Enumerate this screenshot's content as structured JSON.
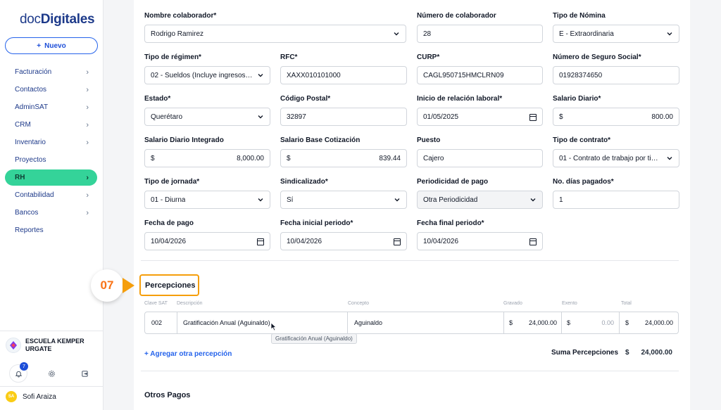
{
  "app": {
    "logo_prefix": "doc",
    "logo_brand": "Digitales",
    "new_button": "Nuevo"
  },
  "sidebar": {
    "items": [
      {
        "label": "Facturación",
        "chevron": true,
        "active": false
      },
      {
        "label": "Contactos",
        "chevron": true,
        "active": false
      },
      {
        "label": "AdminSAT",
        "chevron": true,
        "active": false
      },
      {
        "label": "CRM",
        "chevron": true,
        "active": false
      },
      {
        "label": "Inventario",
        "chevron": true,
        "active": false
      },
      {
        "label": "Proyectos",
        "chevron": false,
        "active": false
      },
      {
        "label": "RH",
        "chevron": true,
        "active": true
      },
      {
        "label": "Contabilidad",
        "chevron": true,
        "active": false
      },
      {
        "label": "Bancos",
        "chevron": true,
        "active": false
      },
      {
        "label": "Reportes",
        "chevron": false,
        "active": false
      }
    ],
    "org_name": "ESCUELA KEMPER URGATE",
    "notification_count": "7",
    "user_initials": "SA",
    "user_name": "Sofi Araiza"
  },
  "form": {
    "nombre_colaborador": {
      "label": "Nombre colaborador*",
      "value": "Rodrigo Ramirez"
    },
    "numero_colaborador": {
      "label": "Número de colaborador",
      "value": "28"
    },
    "tipo_nomina": {
      "label": "Tipo de Nómina",
      "value": "E - Extraordinaria"
    },
    "tipo_regimen": {
      "label": "Tipo de régimen*",
      "value": "02 - Sueldos (Incluye ingresos se..."
    },
    "rfc": {
      "label": "RFC*",
      "value": "XAXX010101000"
    },
    "curp": {
      "label": "CURP*",
      "value": "CAGL950715HMCLRN09"
    },
    "nss": {
      "label": "Número de Seguro Social*",
      "value": "01928374650"
    },
    "estado": {
      "label": "Estado*",
      "value": "Querétaro"
    },
    "codigo_postal": {
      "label": "Código Postal*",
      "value": "32897"
    },
    "inicio_relacion": {
      "label": "Inicio de relación laboral*",
      "value": "01/05/2025"
    },
    "salario_diario": {
      "label": "Salario Diario*",
      "currency": "$",
      "value": "800.00"
    },
    "sdi": {
      "label": "Salario Diario Integrado",
      "currency": "$",
      "value": "8,000.00"
    },
    "sbc": {
      "label": "Salario Base Cotización",
      "currency": "$",
      "value": "839.44"
    },
    "puesto": {
      "label": "Puesto",
      "value": "Cajero"
    },
    "tipo_contrato": {
      "label": "Tipo de contrato*",
      "value": "01 - Contrato de trabajo por tiem..."
    },
    "tipo_jornada": {
      "label": "Tipo de jornada*",
      "value": "01 - Diurna"
    },
    "sindicalizado": {
      "label": "Sindicalizado*",
      "value": "Sí"
    },
    "periodicidad": {
      "label": "Periodicidad de pago",
      "value": "Otra Periodicidad"
    },
    "dias_pagados": {
      "label": "No. días pagados*",
      "value": "1"
    },
    "fecha_pago": {
      "label": "Fecha de pago",
      "value": "10/04/2026"
    },
    "fecha_inicial": {
      "label": "Fecha inicial periodo*",
      "value": "10/04/2026"
    },
    "fecha_final": {
      "label": "Fecha final periodo*",
      "value": "10/04/2026"
    }
  },
  "step": {
    "number": "07",
    "color": "#f59e0b"
  },
  "percepciones": {
    "title": "Percepciones",
    "columns": [
      "Clave SAT",
      "Descripción",
      "Concepto",
      "Gravado",
      "Exento",
      "Total"
    ],
    "rows": [
      {
        "clave": "002",
        "descripcion": "Gratificación Anual (Aguinaldo)",
        "concepto": "Aguinaldo",
        "gravado_cur": "$",
        "gravado": "24,000.00",
        "exento_cur": "$",
        "exento": "0.00",
        "total_cur": "$",
        "total": "24,000.00"
      }
    ],
    "tooltip": "Gratificación Anual (Aguinaldo)",
    "add_link": "+ Agregar otra percepción",
    "sum_label": "Suma Percepciones",
    "sum_currency": "$",
    "sum_value": "24,000.00"
  },
  "otros_pagos": {
    "title": "Otros Pagos"
  },
  "colors": {
    "accent": "#34d399",
    "brand": "#1d3a8a",
    "link": "#2563eb",
    "highlight": "#f59e0b"
  }
}
